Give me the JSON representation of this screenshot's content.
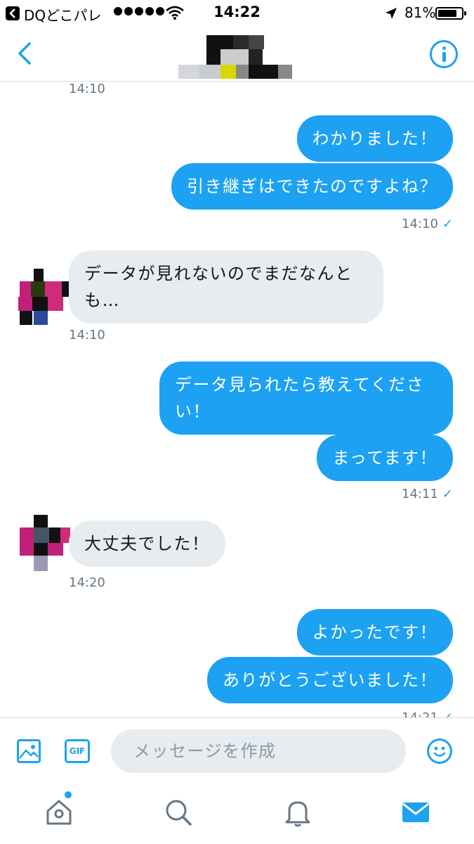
{
  "status_bar": {
    "back_app": "DQどこパレ",
    "time": "14:22",
    "battery_percent": "81%",
    "battery_level": 0.81
  },
  "header": {
    "back_icon": "chevron-left-icon",
    "info_icon": "info-icon"
  },
  "messages": [
    {
      "kind": "timestamp",
      "text": "14:10"
    },
    {
      "kind": "out",
      "text": "わかりました！"
    },
    {
      "kind": "out",
      "text": "引き継ぎはできたのですよね？"
    },
    {
      "kind": "timestamp",
      "text": "14:10",
      "check": "✓"
    },
    {
      "kind": "in",
      "text": "データが見れないのでまだなんとも…"
    },
    {
      "kind": "timestamp",
      "text": "14:10"
    },
    {
      "kind": "out",
      "text": "データ見られたら教えてください！"
    },
    {
      "kind": "out",
      "text": "まってます！"
    },
    {
      "kind": "timestamp",
      "text": "14:11",
      "check": "✓"
    },
    {
      "kind": "in",
      "text": "大丈夫でした！"
    },
    {
      "kind": "timestamp",
      "text": "14:20"
    },
    {
      "kind": "out",
      "text": "よかったです！"
    },
    {
      "kind": "out",
      "text": "ありがとうございました！"
    },
    {
      "kind": "timestamp",
      "text": "14:21",
      "check": "✓"
    }
  ],
  "composer": {
    "placeholder": "メッセージを作成",
    "gif_label": "GIF"
  },
  "tabbar": {
    "items": [
      "home-icon",
      "search-icon",
      "notifications-icon",
      "messages-icon"
    ],
    "active": "messages-icon"
  },
  "colors": {
    "accent": "#1da1f2",
    "incoming_bubble": "#e6ecf0",
    "timestamp": "#657786"
  }
}
